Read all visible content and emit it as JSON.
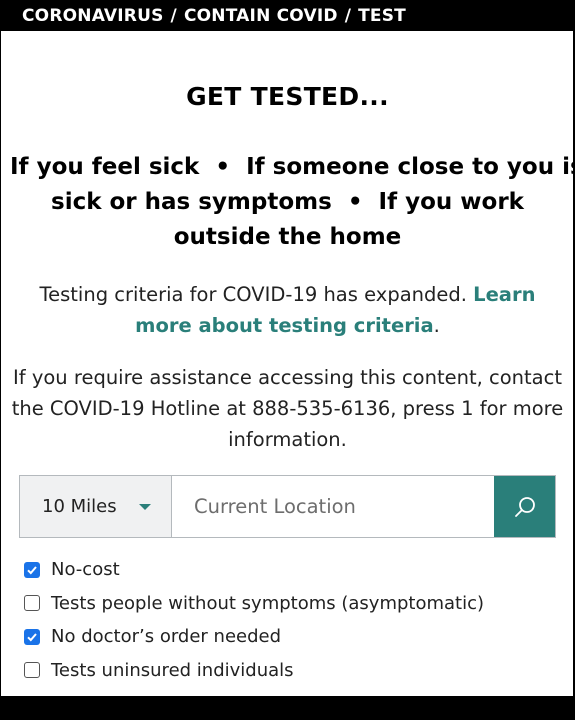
{
  "breadcrumb": {
    "items": [
      "CORONAVIRUS",
      "CONTAIN COVID",
      "TEST"
    ],
    "separator": "/"
  },
  "page": {
    "title": "GET TESTED...",
    "criteria_line1": "If you feel sick  •  If someone close to you is",
    "criteria_line2": "sick or has symptoms  •  If you work",
    "criteria_line3": "outside the home",
    "expanded_text": "Testing criteria for COVID-19 has expanded.",
    "learn_more_link": "Learn more about testing criteria",
    "expanded_suffix": ".",
    "assistance_text": "If you require assistance accessing this content, contact the COVID-19 Hotline at 888-535-6136, press 1 for more information."
  },
  "search": {
    "distance_value": "10 Miles",
    "location_placeholder": "Current Location",
    "search_icon": "search-icon"
  },
  "filters": [
    {
      "label": "No-cost",
      "checked": true
    },
    {
      "label": "Tests people without symptoms (asymptomatic)",
      "checked": false
    },
    {
      "label": "No doctor’s order needed",
      "checked": true
    },
    {
      "label": "Tests uninsured individuals",
      "checked": false
    }
  ],
  "colors": {
    "accent": "#2a7f7a",
    "checkbox_checked": "#1a73e8",
    "bar": "#000000"
  }
}
